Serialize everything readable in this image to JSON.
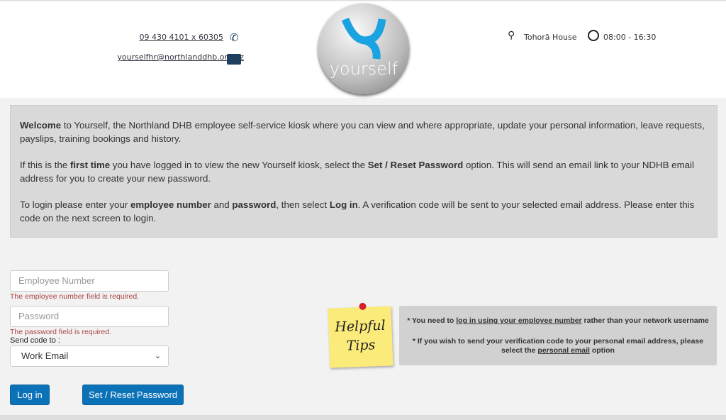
{
  "header": {
    "phone": "09 430 4101 x 60305",
    "email": "yourselfhr@northlanddhb.org.nz",
    "logo_text": "yourself",
    "location": "Tohorā House",
    "hours": "08:00 - 16:30",
    "brand_color": "#1aa3e0"
  },
  "info": {
    "p1": {
      "b": "Welcome",
      "t": " to Yourself, the Northland DHB employee self-service kiosk where you can view and where appropriate, update your personal information, leave requests, payslips, training bookings and history."
    },
    "p2": {
      "t1": "If this is the ",
      "b1": "first time",
      "t2": " you have logged in to view the new Yourself kiosk, select the ",
      "b2": "Set / Reset Password",
      "t3": " option. This will send an email link to your NDHB email address for you to create your new password."
    },
    "p3": {
      "t1": "To login please enter your ",
      "b1": "employee number",
      "t2": " and ",
      "b2": "password",
      "t3": ", then select ",
      "b3": "Log in",
      "t4": ". A verification code will be sent to your selected email address. Please enter this code on the next screen to login."
    }
  },
  "form": {
    "employee_placeholder": "Employee Number",
    "employee_error": "The employee number field is required.",
    "password_placeholder": "Password",
    "password_error": "The password field is required.",
    "send_code_label": "Send code to :",
    "send_code_value": "Work Email",
    "login": "Log in",
    "reset": "Set / Reset Password"
  },
  "tips": {
    "note_line1": "Helpful",
    "note_line2": "Tips",
    "t1a": "* You need to ",
    "t1link": "log in using your employee number",
    "t1b": " rather than your network username",
    "t2a": "* If you wish to send your verification code to your personal email address, please select the ",
    "t2link": "personal email",
    "t2b": " option"
  }
}
